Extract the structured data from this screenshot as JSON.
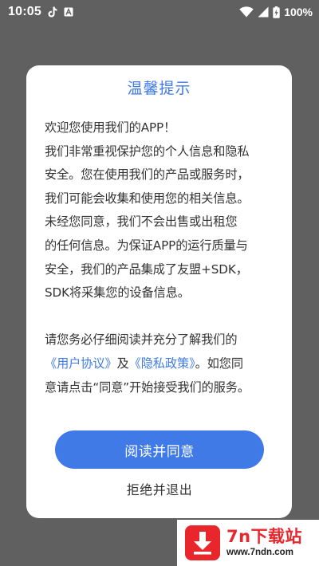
{
  "status_bar": {
    "time": "10:05",
    "battery": "100%",
    "icons": [
      "tiktok-icon",
      "notification-a-icon",
      "wifi-icon",
      "signal-icon",
      "battery-charging-icon"
    ]
  },
  "dialog": {
    "title": "温馨提示",
    "paragraph1": [
      "欢迎您使用我们的APP！",
      "我们非常重视保护您的个人信息和隐私",
      "安全。您在使用我们的产品或服务时，",
      "我们可能会收集和使用您的相关信息。",
      "未经您同意，我们不会出售或出租您",
      "的任何信息。为保证APP的运行质量与",
      "安全，我们的产品集成了友盟+SDK，",
      "SDK将采集您的设备信息。"
    ],
    "paragraph2": {
      "line1": "请您务必仔细阅读并充分了解我们的",
      "user_agreement_link": "《用户协议》",
      "conjunction": "及",
      "privacy_policy_link": "《隐私政策》",
      "line2_tail": "。如您同",
      "line3": "意请点击“同意”开始接受我们的服务。"
    },
    "agree_button": "阅读并同意",
    "reject_button": "拒绝并退出"
  },
  "watermark": {
    "brand": "7n下载站",
    "url": "www.7ndn.com"
  },
  "colors": {
    "accent": "#3f7ae6",
    "overlay": "#606060",
    "watermark_red": "#e8262c"
  }
}
